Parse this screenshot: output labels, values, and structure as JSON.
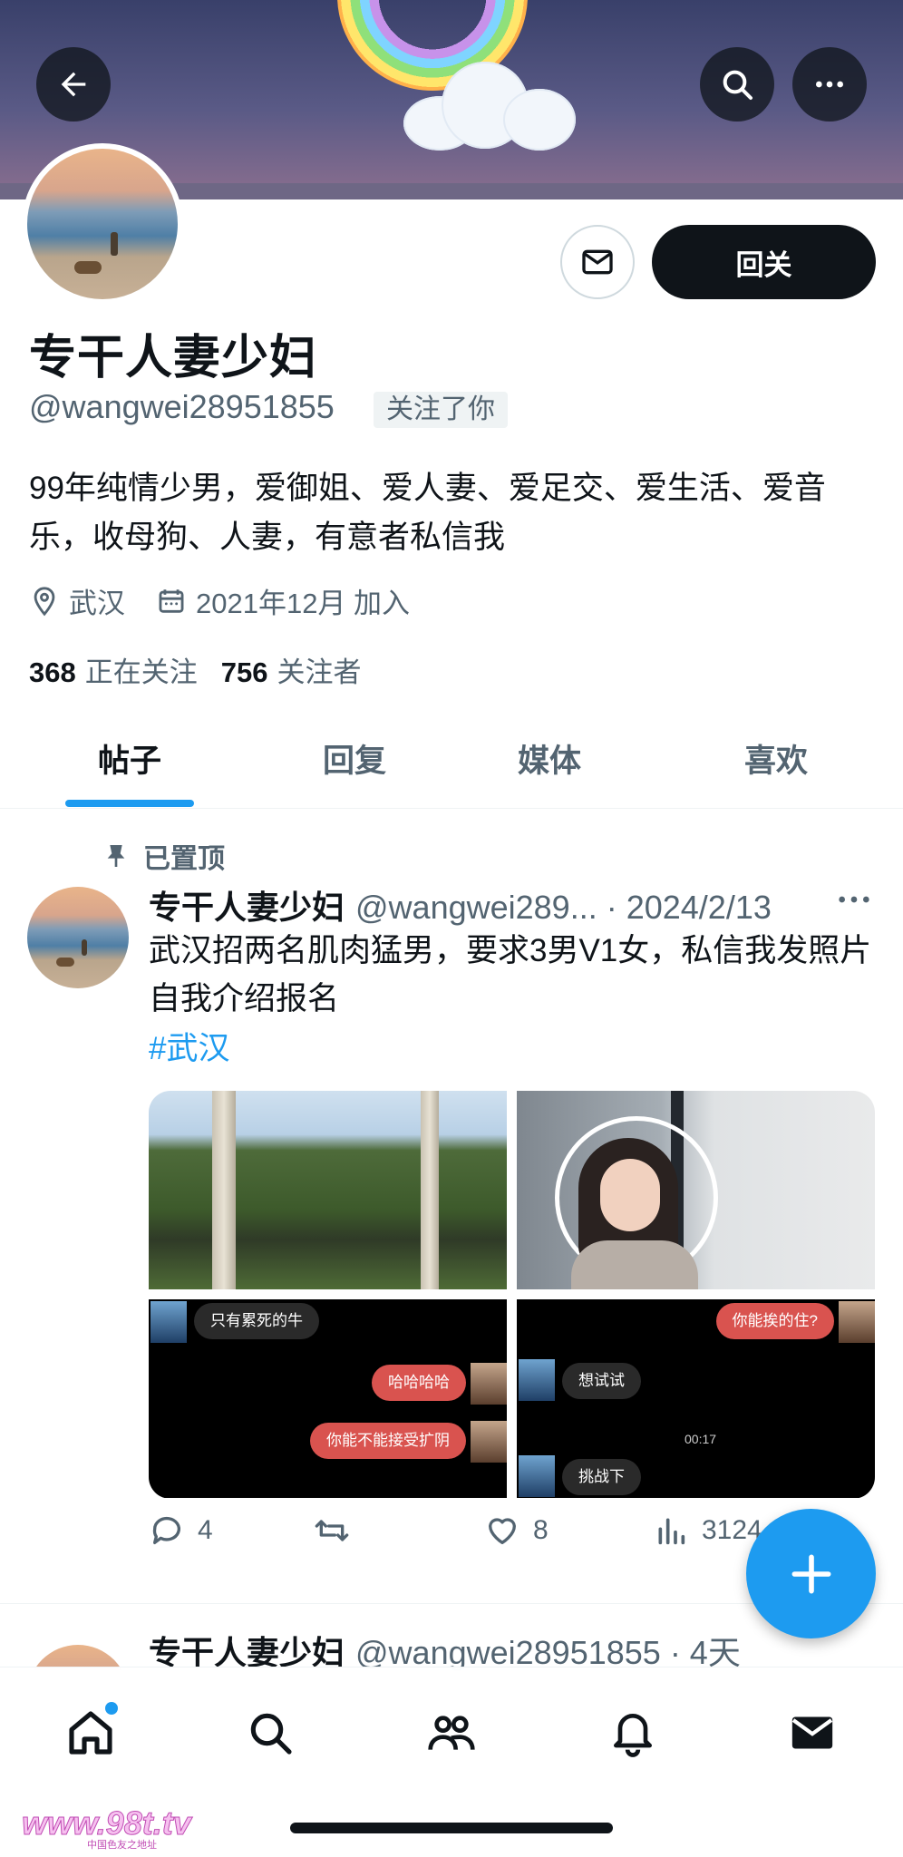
{
  "header": {
    "back_icon": "arrow-left-icon",
    "search_icon": "search-icon",
    "more_icon": "more-horizontal-icon"
  },
  "profile": {
    "name": "专干人妻少妇",
    "handle": "@wangwei28951855",
    "follows_you_badge": "关注了你",
    "follow_back_label": "回关",
    "message_icon": "envelope-icon",
    "bio": "99年纯情少男，爱御姐、爱人妻、爱足交、爱生活、爱音乐，收母狗、人妻，有意者私信我",
    "location": "武汉",
    "joined": "2021年12月 加入",
    "following_count": "368",
    "following_label": "正在关注",
    "followers_count": "756",
    "followers_label": "关注者"
  },
  "tabs": [
    {
      "label": "帖子",
      "active": true
    },
    {
      "label": "回复",
      "active": false
    },
    {
      "label": "媒体",
      "active": false
    },
    {
      "label": "喜欢",
      "active": false
    }
  ],
  "pinned_post": {
    "pinned_label": "已置顶",
    "author": "专干人妻少妇",
    "handle_date": "@wangwei289... · 2024/2/13",
    "text": "武汉招两名肌肉猛男，要求3男V1女，私信我发照片自我介绍报名",
    "hashtag": "#武汉",
    "chat_left": {
      "b1": "只有累死的牛",
      "b2": "哈哈哈哈",
      "b3": "你能不能接受扩阴"
    },
    "chat_right": {
      "b1": "你能挨的住?",
      "b2": "想试试",
      "time": "00:17",
      "b3": "挑战下"
    },
    "replies": "4",
    "likes": "8",
    "views": "3124"
  },
  "second_post": {
    "author": "专干人妻少妇",
    "handle_date": "@wangwei28951855 · 4天"
  },
  "nav": [
    "home-icon",
    "search-icon",
    "communities-icon",
    "notifications-icon",
    "messages-icon"
  ],
  "watermark": {
    "text": "www.98t.tv",
    "sub": "中国色友之地址"
  },
  "colors": {
    "accent": "#1d9bf0",
    "text": "#0f1419",
    "secondary": "#536471"
  }
}
